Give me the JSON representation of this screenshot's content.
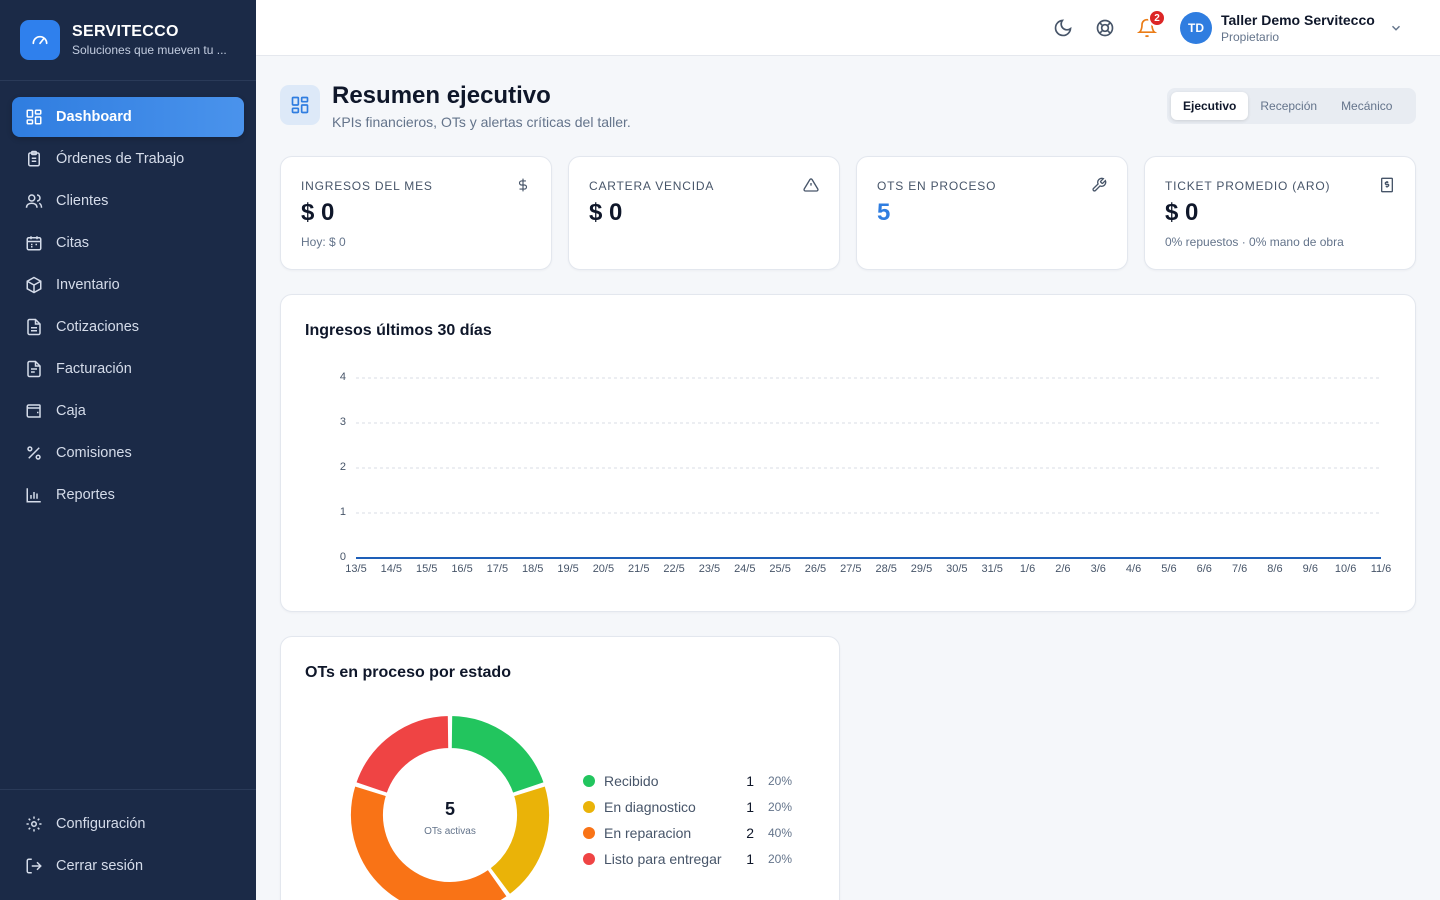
{
  "brand": {
    "name": "SERVITECCO",
    "tagline": "Soluciones que mueven tu ..."
  },
  "nav": {
    "items": [
      {
        "label": "Dashboard",
        "icon": "dashboard-icon",
        "active": true
      },
      {
        "label": "Órdenes de Trabajo",
        "icon": "clipboard-icon"
      },
      {
        "label": "Clientes",
        "icon": "users-icon"
      },
      {
        "label": "Citas",
        "icon": "calendar-icon"
      },
      {
        "label": "Inventario",
        "icon": "package-icon"
      },
      {
        "label": "Cotizaciones",
        "icon": "document-icon"
      },
      {
        "label": "Facturación",
        "icon": "invoice-icon"
      },
      {
        "label": "Caja",
        "icon": "wallet-icon"
      },
      {
        "label": "Comisiones",
        "icon": "percent-icon"
      },
      {
        "label": "Reportes",
        "icon": "bar-chart-icon"
      }
    ],
    "bottom": [
      {
        "label": "Configuración",
        "icon": "gear-icon"
      },
      {
        "label": "Cerrar sesión",
        "icon": "logout-icon"
      }
    ]
  },
  "topbar": {
    "notifications_count": "2",
    "user": {
      "initials": "TD",
      "name": "Taller Demo Servitecco",
      "role": "Propietario"
    }
  },
  "page": {
    "title": "Resumen ejecutivo",
    "subtitle": "KPIs financieros, OTs y alertas críticas del taller.",
    "tabs": [
      {
        "label": "Ejecutivo",
        "active": true
      },
      {
        "label": "Recepción"
      },
      {
        "label": "Mecánico"
      }
    ]
  },
  "kpis": [
    {
      "label": "INGRESOS DEL MES",
      "value": "$ 0",
      "sub": "Hoy: $ 0",
      "icon": "dollar-icon"
    },
    {
      "label": "CARTERA VENCIDA",
      "value": "$ 0",
      "sub": "",
      "icon": "warning-icon"
    },
    {
      "label": "OTS EN PROCESO",
      "value": "5",
      "sub": "",
      "icon": "wrench-icon"
    },
    {
      "label": "TICKET PROMEDIO (ARO)",
      "value": "$ 0",
      "sub": "0% repuestos · 0% mano de obra",
      "icon": "receipt-icon"
    }
  ],
  "colors": {
    "accent": "#2f7de0",
    "sidebar": "#1b2a47",
    "line": "#1e5fb8"
  },
  "chart_data": [
    {
      "type": "line",
      "title": "Ingresos últimos 30 días",
      "x": [
        "13/5",
        "14/5",
        "15/5",
        "16/5",
        "17/5",
        "18/5",
        "19/5",
        "20/5",
        "21/5",
        "22/5",
        "23/5",
        "24/5",
        "25/5",
        "26/5",
        "27/5",
        "28/5",
        "29/5",
        "30/5",
        "31/5",
        "1/6",
        "2/6",
        "3/6",
        "4/6",
        "5/6",
        "6/6",
        "7/6",
        "8/6",
        "9/6",
        "10/6",
        "11/6"
      ],
      "y_ticks": [
        0,
        1,
        2,
        3,
        4
      ],
      "ylim": [
        0,
        4
      ],
      "series": [
        {
          "values": [
            0,
            0,
            0,
            0,
            0,
            0,
            0,
            0,
            0,
            0,
            0,
            0,
            0,
            0,
            0,
            0,
            0,
            0,
            0,
            0,
            0,
            0,
            0,
            0,
            0,
            0,
            0,
            0,
            0,
            0
          ]
        }
      ],
      "grid": true
    },
    {
      "type": "pie",
      "title": "OTs en proceso por estado",
      "center_value": "5",
      "center_label": "OTs activas",
      "slices": [
        {
          "label": "Recibido",
          "value": 1,
          "pct": "20%",
          "color": "#22c55e"
        },
        {
          "label": "En diagnostico",
          "value": 1,
          "pct": "20%",
          "color": "#eab308"
        },
        {
          "label": "En reparacion",
          "value": 2,
          "pct": "40%",
          "color": "#f97316"
        },
        {
          "label": "Listo para entregar",
          "value": 1,
          "pct": "20%",
          "color": "#ef4444"
        }
      ]
    }
  ]
}
